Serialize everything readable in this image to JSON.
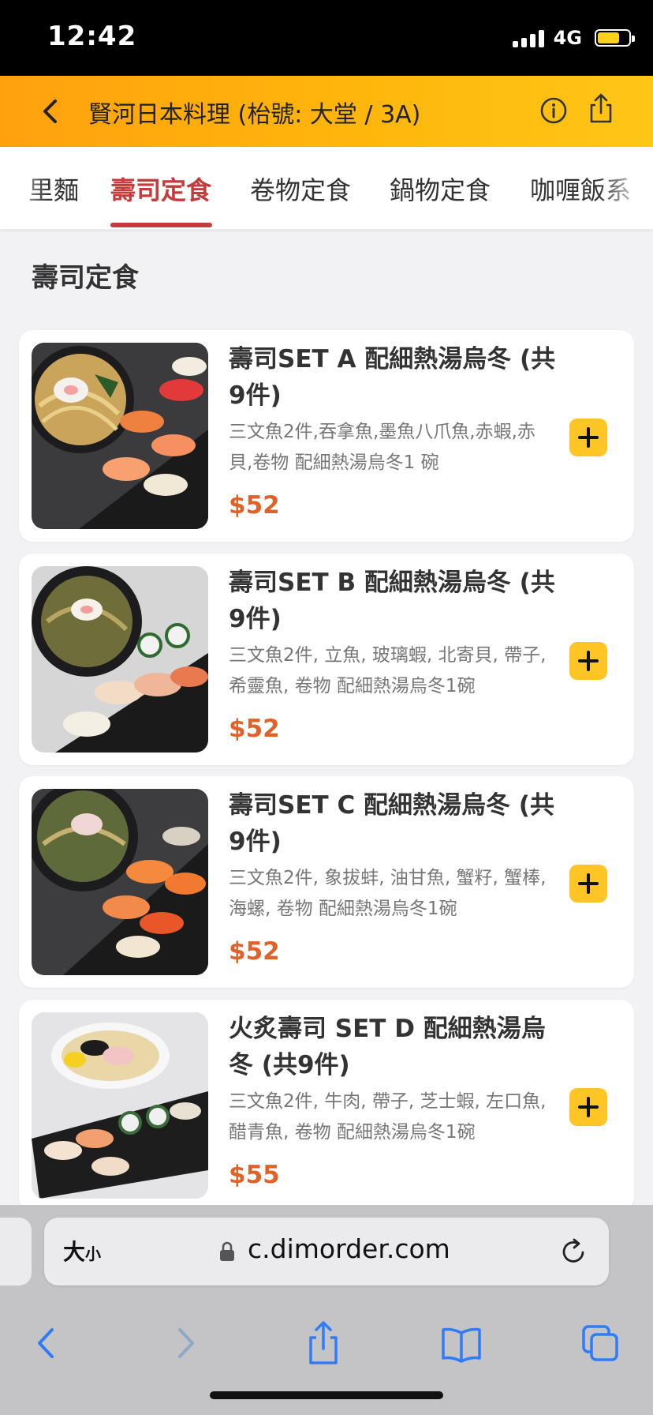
{
  "status_bar": {
    "time": "12:42",
    "network": "4G"
  },
  "header": {
    "title": "賢河日本料理 (枱號: 大堂 / 3A)"
  },
  "tabs": [
    {
      "label": "里麵"
    },
    {
      "label": "壽司定食",
      "active": true
    },
    {
      "label": "卷物定食"
    },
    {
      "label": "鍋物定食"
    },
    {
      "label": "咖喱飯系"
    }
  ],
  "section": {
    "title": "壽司定食"
  },
  "items": [
    {
      "name": "壽司SET A 配細熱湯烏冬 (共9件)",
      "desc": "三文魚2件,吞拿魚,墨魚八爪魚,赤蝦,赤貝,卷物 配細熱湯烏冬1 碗",
      "price": "$52"
    },
    {
      "name": "壽司SET B 配細熱湯烏冬 (共9件)",
      "desc": "三文魚2件, 立魚, 玻璃蝦, 北寄貝, 帶子, 希靈魚, 卷物 配細熱湯烏冬1碗",
      "price": "$52"
    },
    {
      "name": "壽司SET C 配細熱湯烏冬 (共9件)",
      "desc": "三文魚2件, 象拔蚌, 油甘魚, 蟹籽, 蟹棒, 海螺, 卷物 配細熱湯烏冬1碗",
      "price": "$52"
    },
    {
      "name": "火炙壽司 SET D 配細熱湯烏冬 (共9件)",
      "desc": "三文魚2件, 牛肉, 帶子, 芝士蝦, 左口魚, 醋青魚, 卷物 配細熱湯烏冬1碗",
      "price": "$55"
    }
  ],
  "browser": {
    "size_label": "大",
    "size_label_small": "小",
    "url": "c.dimorder.com"
  },
  "colors": {
    "header_accent": "#ffb60c",
    "active_tab": "#c53b3b",
    "price": "#e0622a",
    "add_button": "#ffc525",
    "browser_blue": "#2f7cf6"
  }
}
